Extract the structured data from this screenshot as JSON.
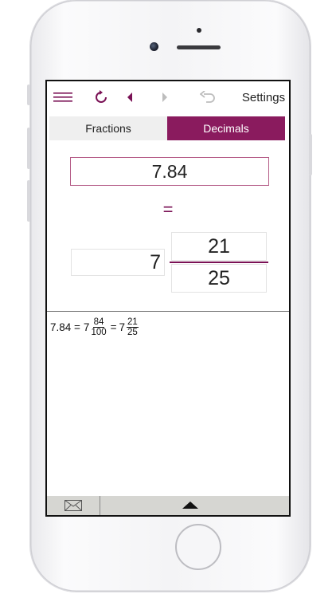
{
  "toolbar": {
    "menu_icon": "menu-icon",
    "reset_icon": "refresh-icon",
    "back_icon": "triangle-left-icon",
    "forward_icon": "triangle-right-icon",
    "undo_icon": "undo-icon",
    "settings_label": "Settings"
  },
  "tabs": [
    {
      "label": "Fractions",
      "active": false
    },
    {
      "label": "Decimals",
      "active": true
    }
  ],
  "converter": {
    "decimal_value": "7.84",
    "equals": "=",
    "whole": "7",
    "numerator": "21",
    "denominator": "25"
  },
  "steps": {
    "lhs": "7.84 =",
    "mid_whole": "7",
    "mid_num": "84",
    "mid_den": "100",
    "eq": "=",
    "res_whole": "7",
    "res_num": "21",
    "res_den": "25"
  },
  "bottom_bar": {
    "mail_icon": "envelope-icon",
    "expand_icon": "chevron-up-icon"
  },
  "colors": {
    "accent": "#8a1b5e",
    "tab_inactive": "#efefef",
    "bottom_bar": "#d6d6d2"
  }
}
